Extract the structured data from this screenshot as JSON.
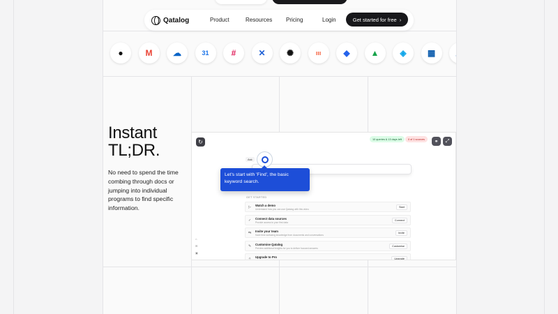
{
  "nav": {
    "logo_text": "Qatalog",
    "links": [
      "Product",
      "Resources",
      "Pricing",
      "Login"
    ],
    "cta_label": "Get started for free",
    "cta_icon": "chevron-right-icon"
  },
  "integrations": [
    {
      "name": "github-icon",
      "glyph": "●",
      "color": "#111111"
    },
    {
      "name": "gmail-icon",
      "glyph": "M",
      "color": "#ea4335"
    },
    {
      "name": "onedrive-icon",
      "glyph": "☁",
      "color": "#0a64c7"
    },
    {
      "name": "google-calendar-icon",
      "glyph": "31",
      "color": "#1a73e8"
    },
    {
      "name": "slack-icon",
      "glyph": "#",
      "color": "#e01e5a"
    },
    {
      "name": "confluence-icon",
      "glyph": "✕",
      "color": "#1d5fd6"
    },
    {
      "name": "openai-icon",
      "glyph": "✺",
      "color": "#111111"
    },
    {
      "name": "monday-icon",
      "glyph": "ııı",
      "color": "#f55f3c"
    },
    {
      "name": "jira-icon",
      "glyph": "◆",
      "color": "#2563eb"
    },
    {
      "name": "google-drive-icon",
      "glyph": "▲",
      "color": "#16a34a"
    },
    {
      "name": "atlassian-icon",
      "glyph": "◈",
      "color": "#0ea5e9"
    },
    {
      "name": "planner-icon",
      "glyph": "▦",
      "color": "#0b5cad"
    },
    {
      "name": "partial-app-icon",
      "glyph": "☁",
      "color": "#0a64c7"
    }
  ],
  "hero": {
    "headline_line1": "Instant",
    "headline_line2": "TL;DR.",
    "body": "No need to spend the time combing through docs or jumping into individual programs to find specific information."
  },
  "app": {
    "usage_badge": "10 queries & 13 days left",
    "status_badge": "0 of 1 sources",
    "ask_chip": "Ask",
    "tooltip": "Let's start with 'Find', the basic keyword search.",
    "section_label": "GET STARTED",
    "tasks": [
      {
        "title": "Watch a demo",
        "subtitle": "Understand how you can use Qatalog with this video",
        "button": "Start",
        "icon": "▷"
      },
      {
        "title": "Connect data sources",
        "subtitle": "Provide access to your first data",
        "button": "Connect",
        "icon": "✓"
      },
      {
        "title": "Invite your team",
        "subtitle": "Save time surfacing knowledge from documents and conversations",
        "button": "Invite",
        "icon": "⇆"
      },
      {
        "title": "Customise Qatalog",
        "subtitle": "Preview additional insights for you to deliver focused answers",
        "button": "Customise",
        "icon": "✎"
      },
      {
        "title": "Upgrade to Pro",
        "subtitle": "Search in integrations, unlimited queries and create work spaces",
        "button": "Upgrade",
        "icon": "✧"
      }
    ],
    "side_items": [
      "⌂",
      "✉",
      "▣"
    ]
  },
  "colors": {
    "accent": "#1d4ed8",
    "cta": "#18181b",
    "usage_badge_bg": "#dcfce7",
    "status_badge_bg": "#fee2e2"
  }
}
